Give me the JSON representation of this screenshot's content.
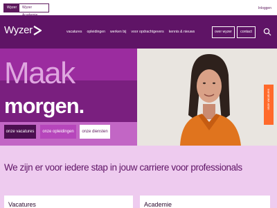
{
  "topbar": {
    "tabs": [
      "Wyzer",
      "Wyzer Academie"
    ],
    "login_label": "Inloggen"
  },
  "header": {
    "logo_text": "Wyzer",
    "nav": [
      "vacatures",
      "opleidingen",
      "werken bij",
      "voor opdrachtgevers",
      "kennis & nieuws"
    ],
    "over_label": "over wyzer",
    "contact_label": "contact"
  },
  "hero": {
    "line1": "Maak",
    "line2": "morgen.",
    "buttons": [
      "onze vacatures",
      "onze opleidingen",
      "onze diensten"
    ],
    "side_tab": "onze vacatures"
  },
  "lower": {
    "tagline": "We zijn er voor iedere stap in jouw carriere voor professionals",
    "cards": [
      "Vacatures",
      "Academie"
    ]
  },
  "colors": {
    "brand_purple": "#5f1466",
    "hero_purple": "#a32fa7",
    "accent_orange": "#ff6a2b",
    "light_pink": "#eecbef"
  }
}
